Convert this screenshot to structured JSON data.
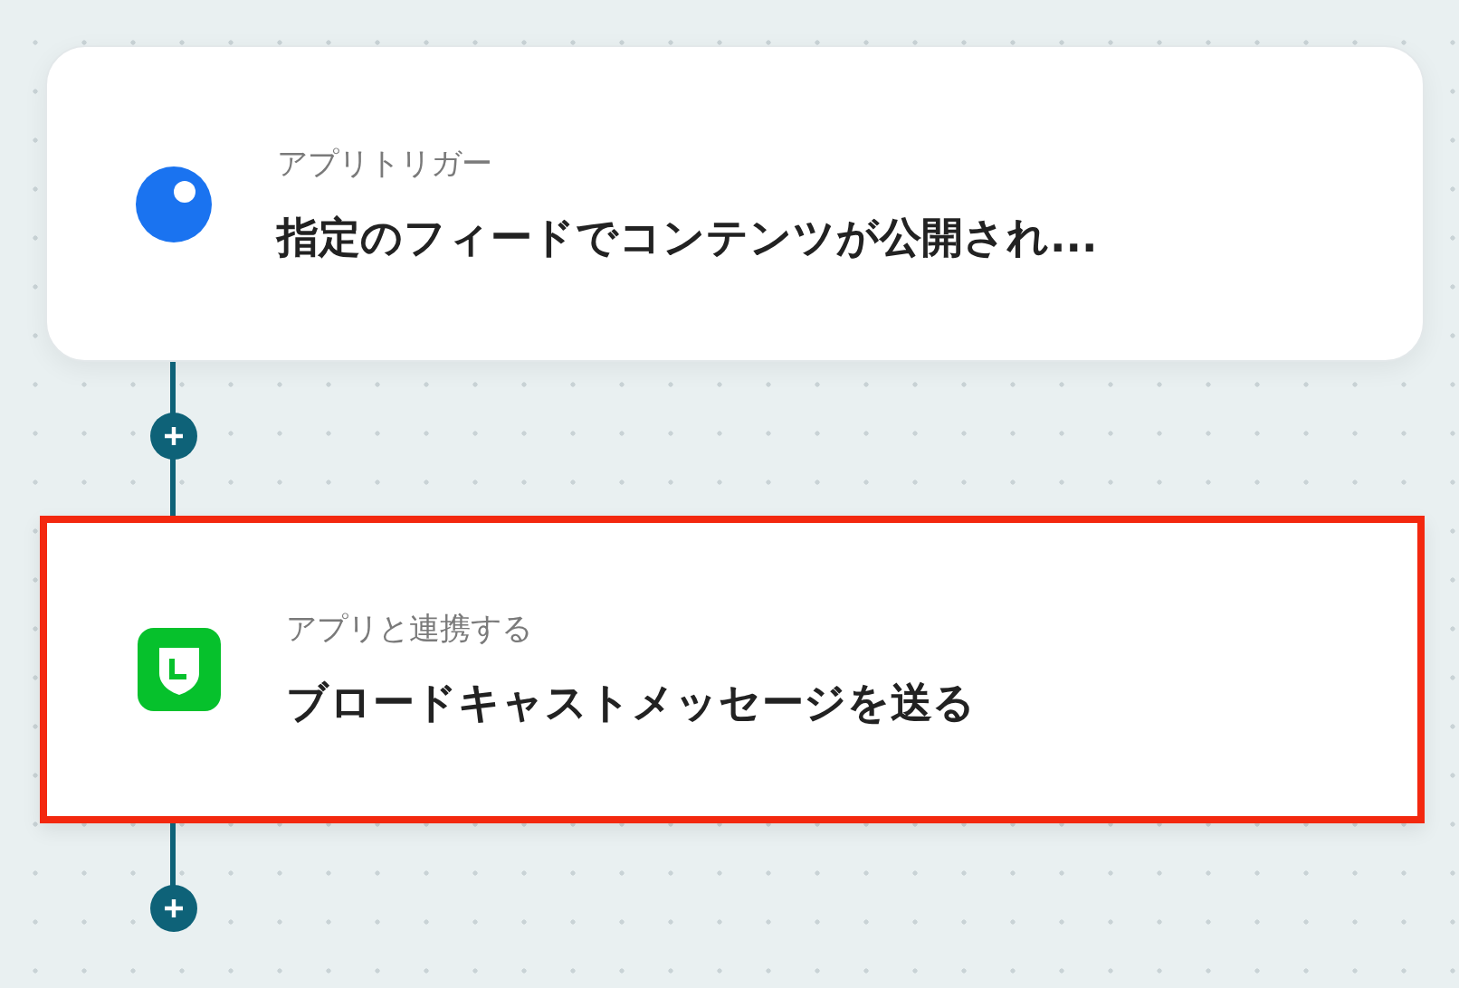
{
  "steps": [
    {
      "kind": "trigger",
      "label": "アプリトリガー",
      "title": "指定のフィードでコンテンツが公開され...",
      "highlighted": false
    },
    {
      "kind": "line",
      "label": "アプリと連携する",
      "title": "ブロードキャストメッセージを送る",
      "highlighted": true
    }
  ]
}
